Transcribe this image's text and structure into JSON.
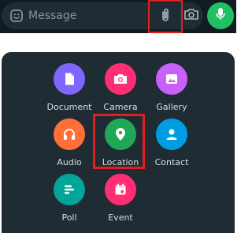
{
  "composer": {
    "placeholder": "Message",
    "icons": {
      "emoji": "sticker-emoji-icon",
      "attach": "paperclip-icon",
      "camera": "camera-icon",
      "mic": "microphone-icon"
    }
  },
  "attach_menu": {
    "items": [
      {
        "label": "Document",
        "icon": "document-icon",
        "color": "#7f66ff"
      },
      {
        "label": "Camera",
        "icon": "camera-icon",
        "color": "#ff2e74"
      },
      {
        "label": "Gallery",
        "icon": "gallery-icon",
        "color": "#c861fa"
      },
      {
        "label": "Audio",
        "icon": "headphones-icon",
        "color": "#ff7038"
      },
      {
        "label": "Location",
        "icon": "location-pin-icon",
        "color": "#1fa855"
      },
      {
        "label": "Contact",
        "icon": "contact-person-icon",
        "color": "#009de2"
      },
      {
        "label": "Poll",
        "icon": "poll-icon",
        "color": "#02a698"
      },
      {
        "label": "Event",
        "icon": "calendar-event-icon",
        "color": "#ff2e74"
      }
    ]
  },
  "colors": {
    "topbar": "#121b22",
    "panel": "#1f2c34",
    "highlight": "#e01f1f",
    "mic": "#21c063"
  }
}
